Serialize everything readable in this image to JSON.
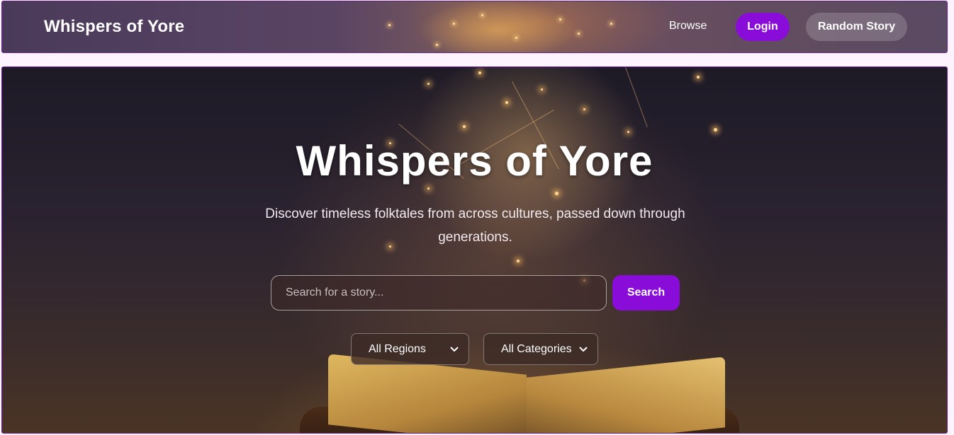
{
  "nav": {
    "brand": "Whispers of Yore",
    "browse": "Browse",
    "login": "Login",
    "random": "Random Story"
  },
  "hero": {
    "title": "Whispers of Yore",
    "subtitle": "Discover timeless folktales from across cultures, passed down through generations.",
    "search_placeholder": "Search for a story...",
    "search_button": "Search",
    "region_select": "All Regions",
    "category_select": "All Categories"
  },
  "colors": {
    "accent": "#8a0cd8",
    "border": "#6a1b9a"
  },
  "icons": {
    "chevron": "chevron-down-icon"
  }
}
